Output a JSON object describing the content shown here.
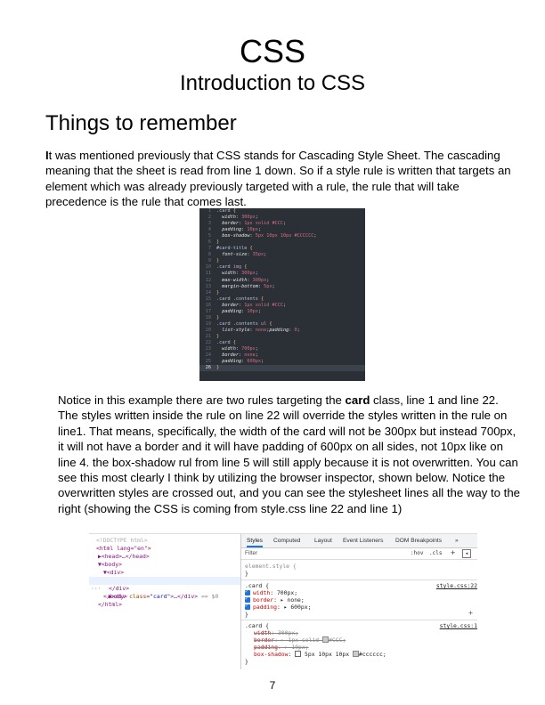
{
  "header": {
    "title": "CSS",
    "subtitle": "Introduction to CSS"
  },
  "section": {
    "heading": "Things to remember"
  },
  "paragraph1": {
    "first_letter": "I",
    "text": "t was mentioned previously that CSS stands for Cascading Style Sheet. The cascading meaning that the sheet is read from line 1 down.  So if a style rule is written that targets an element which was already previously targeted with a rule, the rule that will take precedence is the rule that comes last."
  },
  "code_editor": {
    "lines": [
      {
        "n": "1",
        "segs": [
          {
            "t": ".card ",
            "c": "c-sel"
          },
          {
            "t": "{",
            "c": "c-brace"
          }
        ]
      },
      {
        "n": "2",
        "segs": [
          {
            "t": "  width",
            "c": "c-prop"
          },
          {
            "t": ": ",
            "c": ""
          },
          {
            "t": "300px",
            "c": "c-val"
          },
          {
            "t": ";",
            "c": ""
          }
        ]
      },
      {
        "n": "3",
        "segs": [
          {
            "t": "  border",
            "c": "c-prop"
          },
          {
            "t": ": ",
            "c": ""
          },
          {
            "t": "1px solid #CCC",
            "c": "c-val"
          },
          {
            "t": ";",
            "c": ""
          }
        ]
      },
      {
        "n": "4",
        "segs": [
          {
            "t": "  padding",
            "c": "c-prop"
          },
          {
            "t": ": ",
            "c": ""
          },
          {
            "t": "10px",
            "c": "c-val"
          },
          {
            "t": ";",
            "c": ""
          }
        ]
      },
      {
        "n": "5",
        "segs": [
          {
            "t": "  box-shadow",
            "c": "c-prop"
          },
          {
            "t": ": ",
            "c": ""
          },
          {
            "t": "5px 10px 10px #CCCCCC",
            "c": "c-val"
          },
          {
            "t": ";",
            "c": ""
          }
        ]
      },
      {
        "n": "6",
        "segs": [
          {
            "t": "}",
            "c": "c-brace"
          }
        ]
      },
      {
        "n": "7",
        "segs": [
          {
            "t": "#card-title ",
            "c": "c-sel"
          },
          {
            "t": "{",
            "c": "c-brace"
          }
        ]
      },
      {
        "n": "8",
        "segs": [
          {
            "t": "  font-size",
            "c": "c-prop"
          },
          {
            "t": ": ",
            "c": ""
          },
          {
            "t": "35px",
            "c": "c-val"
          },
          {
            "t": ";",
            "c": ""
          }
        ]
      },
      {
        "n": "9",
        "segs": [
          {
            "t": "}",
            "c": "c-brace"
          }
        ]
      },
      {
        "n": "10",
        "segs": [
          {
            "t": ".card ",
            "c": "c-sel"
          },
          {
            "t": "img ",
            "c": "c-kw"
          },
          {
            "t": "{",
            "c": "c-brace"
          }
        ]
      },
      {
        "n": "11",
        "segs": [
          {
            "t": "  width",
            "c": "c-prop"
          },
          {
            "t": ": ",
            "c": ""
          },
          {
            "t": "300px",
            "c": "c-val"
          },
          {
            "t": ";",
            "c": ""
          }
        ]
      },
      {
        "n": "12",
        "segs": [
          {
            "t": "  max-width",
            "c": "c-prop"
          },
          {
            "t": ": ",
            "c": ""
          },
          {
            "t": "300px",
            "c": "c-val"
          },
          {
            "t": ";",
            "c": ""
          }
        ]
      },
      {
        "n": "13",
        "segs": [
          {
            "t": "  margin-bottom",
            "c": "c-prop"
          },
          {
            "t": ": ",
            "c": ""
          },
          {
            "t": "5px",
            "c": "c-val"
          },
          {
            "t": ";",
            "c": ""
          }
        ]
      },
      {
        "n": "14",
        "segs": [
          {
            "t": "}",
            "c": "c-brace"
          }
        ]
      },
      {
        "n": "15",
        "segs": [
          {
            "t": ".card .contents ",
            "c": "c-sel"
          },
          {
            "t": "{",
            "c": "c-brace"
          }
        ]
      },
      {
        "n": "16",
        "segs": [
          {
            "t": "  border",
            "c": "c-prop"
          },
          {
            "t": ": ",
            "c": ""
          },
          {
            "t": "1px solid #CCC",
            "c": "c-val"
          },
          {
            "t": ";",
            "c": ""
          }
        ]
      },
      {
        "n": "17",
        "segs": [
          {
            "t": "  padding",
            "c": "c-prop"
          },
          {
            "t": ": ",
            "c": ""
          },
          {
            "t": "10px",
            "c": "c-val"
          },
          {
            "t": ";",
            "c": ""
          }
        ]
      },
      {
        "n": "18",
        "segs": [
          {
            "t": "}",
            "c": "c-brace"
          }
        ]
      },
      {
        "n": "19",
        "segs": [
          {
            "t": ".card .contents ",
            "c": "c-sel"
          },
          {
            "t": "ul ",
            "c": "c-kw"
          },
          {
            "t": "{",
            "c": "c-brace"
          }
        ]
      },
      {
        "n": "20",
        "segs": [
          {
            "t": "  list-style",
            "c": "c-prop"
          },
          {
            "t": ": ",
            "c": ""
          },
          {
            "t": "none",
            "c": "c-val"
          },
          {
            "t": ";",
            "c": ""
          },
          {
            "t": "padding",
            "c": "c-prop"
          },
          {
            "t": ": ",
            "c": ""
          },
          {
            "t": "0",
            "c": "c-val"
          },
          {
            "t": ";",
            "c": ""
          }
        ]
      },
      {
        "n": "21",
        "segs": [
          {
            "t": "}",
            "c": "c-brace"
          }
        ]
      },
      {
        "n": "22",
        "segs": [
          {
            "t": ".card ",
            "c": "c-sel"
          },
          {
            "t": "{",
            "c": "c-brace"
          }
        ]
      },
      {
        "n": "23",
        "segs": [
          {
            "t": "  width",
            "c": "c-prop"
          },
          {
            "t": ": ",
            "c": ""
          },
          {
            "t": "700px",
            "c": "c-val"
          },
          {
            "t": ";",
            "c": ""
          }
        ]
      },
      {
        "n": "24",
        "segs": [
          {
            "t": "  border",
            "c": "c-prop"
          },
          {
            "t": ": ",
            "c": ""
          },
          {
            "t": "none",
            "c": "c-val"
          },
          {
            "t": ";",
            "c": ""
          }
        ]
      },
      {
        "n": "25",
        "segs": [
          {
            "t": "  padding",
            "c": "c-prop"
          },
          {
            "t": ": ",
            "c": ""
          },
          {
            "t": "600px",
            "c": "c-val"
          },
          {
            "t": ";",
            "c": ""
          }
        ]
      },
      {
        "n": "26",
        "segs": [
          {
            "t": "}",
            "c": "c-brace"
          }
        ],
        "active": true
      }
    ]
  },
  "paragraph2": {
    "before": "Notice in this example there are two rules targeting the ",
    "bold": "card",
    "after": " class, line 1 and line 22.  The styles written inside the rule on line 22 will override the styles written in the rule on line1.  That means, specifically, the width of the card will not be 300px but instead 700px, it will not have a border and it will have padding of 600px on all sides, not 10px like on line 4.  the box-shadow rul from line 5 will still apply because it is not overwritten.  You can see this most clearly I think by utilizing the browser inspector, shown below. Notice the overwritten styles are crossed out, and you can see the stylesheet lines all the way to the right (showing the CSS is coming from style.css line 22 and line 1)"
  },
  "devtools": {
    "dom": {
      "doctype": "<!DOCTYPE html>",
      "html_open": "<html lang=\"en\">",
      "head": "▶<head>…</head>",
      "body_open": "▼<body>",
      "div_open": "▼<div>",
      "selected_prefix": "▶<div ",
      "selected_attr_name": "class",
      "selected_attr_val": "\"card\"",
      "selected_suffix": ">…</div>",
      "dollar0": "== $0",
      "dots": "···",
      "div_close": "</div>",
      "body_close": "</body>",
      "html_close": "</html>"
    },
    "tabs": [
      "Styles",
      "Computed",
      "Layout",
      "Event Listeners",
      "DOM Breakpoints",
      "»"
    ],
    "filter_placeholder": "Filter",
    "hov": ":hov",
    "cls": ".cls",
    "plus": "+",
    "element_style": "element.style {",
    "close_brace": "}",
    "rule1": {
      "selector": ".card {",
      "source": "style.css:22",
      "props": [
        {
          "name": "width",
          "value": " 700px;"
        },
        {
          "name": "border",
          "value": " ▸ none;"
        },
        {
          "name": "padding",
          "value": " ▸ 600px;"
        }
      ]
    },
    "rule2": {
      "selector": ".card {",
      "source": "style.css:1",
      "props": [
        {
          "name": "width",
          "value": " 300px;",
          "struck": true
        },
        {
          "name": "border",
          "value": " ▸ 1px solid ",
          "tail": "#CCC;",
          "struck": true,
          "swatch": true
        },
        {
          "name": "padding",
          "value": " ▸ 10px;",
          "struck": true
        },
        {
          "name": "box-shadow",
          "value": " 5px 10px 10px ",
          "tail": "#cccccc;",
          "struck": false,
          "shadow": true
        }
      ]
    }
  },
  "footer": {
    "page_number": "7"
  }
}
